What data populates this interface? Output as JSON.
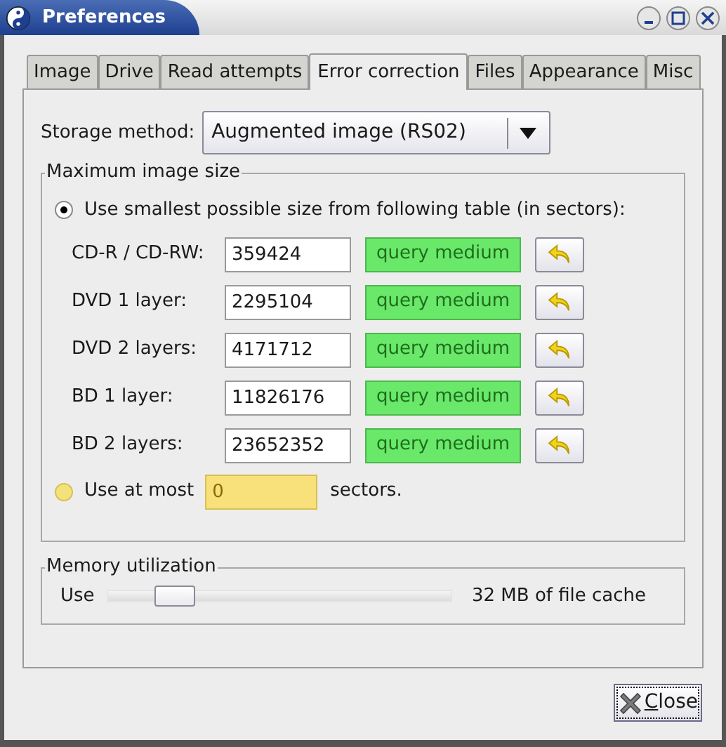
{
  "window": {
    "title": "Preferences"
  },
  "tabs": [
    {
      "label": "Image",
      "selected": false
    },
    {
      "label": "Drive",
      "selected": false
    },
    {
      "label": "Read attempts",
      "selected": false
    },
    {
      "label": "Error correction",
      "selected": true
    },
    {
      "label": "Files",
      "selected": false
    },
    {
      "label": "Appearance",
      "selected": false
    },
    {
      "label": "Misc",
      "selected": false
    }
  ],
  "storage_method": {
    "label": "Storage method:",
    "value": "Augmented image (RS02)"
  },
  "maximum_image_size": {
    "title": "Maximum image size",
    "options": [
      {
        "label": "Use smallest possible size from following table (in sectors):",
        "selected": true
      },
      {
        "label": "Use at most",
        "selected": false,
        "value": "0",
        "suffix": "sectors."
      }
    ],
    "media": [
      {
        "label": "CD-R / CD-RW:",
        "value": "359424",
        "button": "query medium"
      },
      {
        "label": "DVD 1 layer:",
        "value": "2295104",
        "button": "query medium"
      },
      {
        "label": "DVD 2 layers:",
        "value": "4171712",
        "button": "query medium"
      },
      {
        "label": "BD 1 layer:",
        "value": "11826176",
        "button": "query medium"
      },
      {
        "label": "BD 2 layers:",
        "value": "23652352",
        "button": "query medium"
      }
    ]
  },
  "memory_utilization": {
    "title": "Memory utilization",
    "label": "Use",
    "level": 0.15,
    "reading": "32 MB of file cache"
  },
  "close_button": {
    "label": "Close",
    "mnemonic_underlined": true
  }
}
